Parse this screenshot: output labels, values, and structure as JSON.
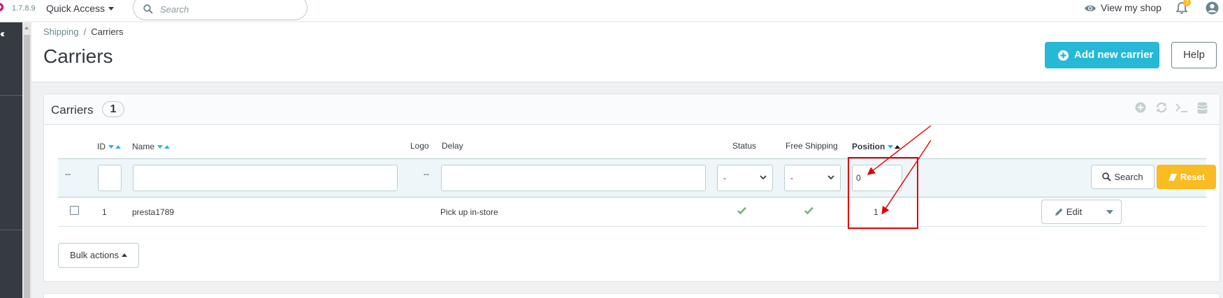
{
  "header": {
    "version": "1.7.8.9",
    "quick_access": "Quick Access",
    "search_placeholder": "Search",
    "view_shop": "View my shop",
    "notification_count": "7"
  },
  "breadcrumb": {
    "parent": "Shipping",
    "separator": "/",
    "current": "Carriers"
  },
  "page": {
    "title": "Carriers",
    "add_button": "Add new carrier",
    "help_button": "Help"
  },
  "panel": {
    "title": "Carriers",
    "count": "1",
    "columns": {
      "id": "ID",
      "name": "Name",
      "logo": "Logo",
      "delay": "Delay",
      "status": "Status",
      "free_shipping": "Free Shipping",
      "position": "Position"
    },
    "filters": {
      "bulk_dash": "--",
      "id_value": "",
      "name_value": "",
      "logo_dash": "--",
      "delay_value": "",
      "status_selected": "-",
      "free_shipping_selected": "-",
      "position_value": "0",
      "search_button": "Search",
      "reset_button": "Reset"
    },
    "rows": [
      {
        "id": "1",
        "name": "presta1789",
        "delay": "Pick up in-store",
        "status": "enabled",
        "free_shipping": "enabled",
        "position": "1",
        "edit_label": "Edit"
      }
    ],
    "bulk_actions": "Bulk actions"
  },
  "colors": {
    "accent": "#25b9d7",
    "warning": "#fbbb22",
    "success": "#70b580",
    "annotation": "#e00000",
    "sidebar": "#363a41",
    "brand": "#df0067"
  }
}
